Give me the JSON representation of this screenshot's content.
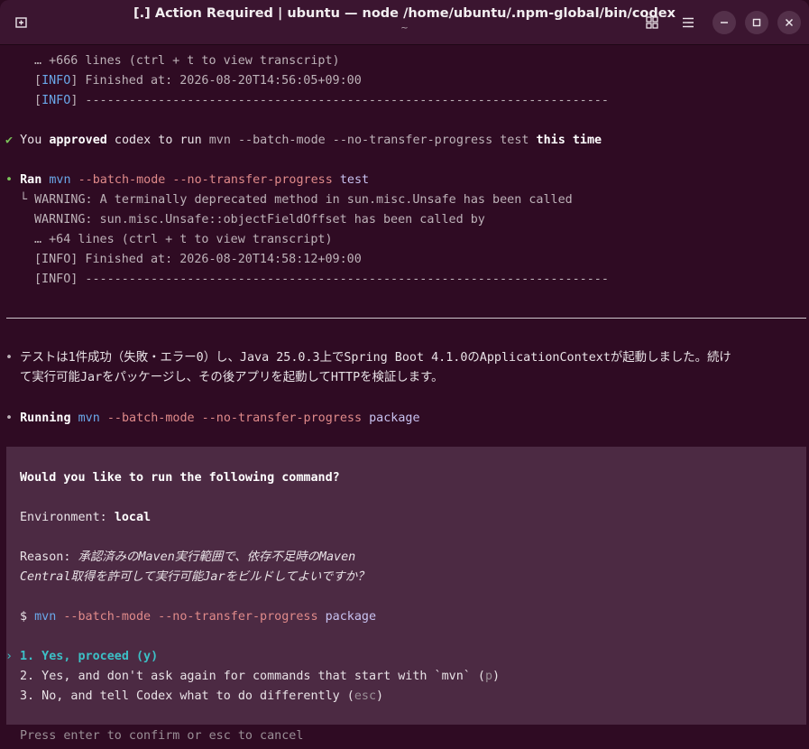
{
  "window": {
    "title": "[.] Action Required | ubuntu — node /home/ubuntu/.npm-global/bin/codex",
    "subtitle": "~"
  },
  "icons": {
    "new_tab": "new-tab-icon",
    "grid": "grid-icon",
    "menu": "hamburger-menu-icon",
    "minimize": "minimize-icon",
    "maximize": "maximize-icon",
    "close": "close-icon"
  },
  "log1": {
    "more_lines": "… +666 lines (ctrl + t to view transcript)",
    "info_open": "[",
    "info_tag": "INFO",
    "info_close": "]",
    "finished": " Finished at: 2026-08-20T14:56:05+09:00",
    "separator": " ------------------------------------------------------------------------"
  },
  "approval": {
    "check": "✔",
    "you": "You ",
    "approved": "approved",
    "middle": " codex to run ",
    "command": "mvn --batch-mode --no-transfer-progress test",
    "this_time": "this time"
  },
  "ran": {
    "bullet": "•",
    "label": "Ran",
    "cmd_name": "mvn",
    "cmd_flags": "--batch-mode --no-transfer-progress",
    "cmd_goal": "test",
    "tree": "└",
    "out1": "WARNING: A terminally deprecated method in sun.misc.Unsafe has been called",
    "out2": "WARNING: sun.misc.Unsafe::objectFieldOffset has been called by",
    "out3": "… +64 lines (ctrl + t to view transcript)",
    "out4": "[INFO] Finished at: 2026-08-20T14:58:12+09:00",
    "out5": "[INFO] ------------------------------------------------------------------------"
  },
  "message": {
    "bullet": "•",
    "line1": "テストは1件成功（失敗・エラー0）し、Java 25.0.3上でSpring Boot 4.1.0のApplicationContextが起動しました。続け",
    "line2": "て実行可能Jarをパッケージし、その後アプリを起動してHTTPを検証します。"
  },
  "running": {
    "bullet": "•",
    "label": "Running",
    "cmd_name": "mvn",
    "cmd_flags": "--batch-mode --no-transfer-progress",
    "cmd_goal": "package"
  },
  "prompt": {
    "question": "Would you like to run the following command?",
    "env_label": "Environment: ",
    "env_value": "local",
    "reason_label": "Reason: ",
    "reason_line1": "承認済みのMaven実行範囲で、依存不足時のMaven",
    "reason_line2": "Central取得を許可して実行可能Jarをビルドしてよいですか？",
    "dollar": "$ ",
    "cmd_name": "mvn",
    "cmd_flags": "--batch-mode --no-transfer-progress",
    "cmd_goal": "package",
    "pointer": "›",
    "option1": "1. Yes, proceed (y)",
    "option2_text": "2. Yes, and don't ask again for commands that start with `mvn` (",
    "option2_key": "p",
    "option2_end": ")",
    "option3_text": "3. No, and tell Codex what to do differently (",
    "option3_key": "esc",
    "option3_end": ")"
  },
  "footer": {
    "hint": "Press enter to confirm or esc to cancel"
  }
}
